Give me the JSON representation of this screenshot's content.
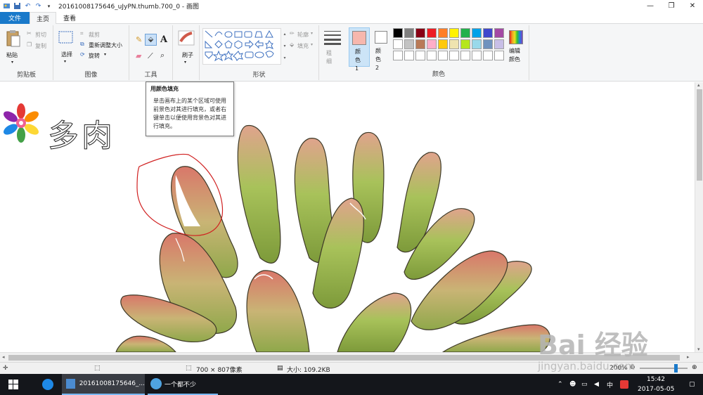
{
  "title_bar": {
    "title": "20161008175646_uJyPN.thumb.700_0 - 画图",
    "minimize": "—",
    "maximize": "❐",
    "close": "✕"
  },
  "tabs": {
    "file": "文件",
    "home": "主页",
    "view": "查看"
  },
  "ribbon": {
    "clipboard": {
      "paste": "粘贴",
      "cut": "剪切",
      "copy": "复制",
      "label": "剪贴板"
    },
    "image": {
      "select": "选择",
      "crop": "裁剪",
      "resize": "重新调整大小",
      "rotate": "旋转",
      "label": "图像"
    },
    "tools": {
      "label": "工具"
    },
    "brushes": {
      "label": "刷子"
    },
    "shapes": {
      "outline": "轮廓",
      "fill": "填充",
      "label": "形状"
    },
    "size": {
      "label": "粗细"
    },
    "colors": {
      "color1": "颜色 1",
      "color2": "颜色 2",
      "edit": "编辑颜色",
      "label": "颜色",
      "color1_value": "#f7b7ad",
      "color2_value": "#ffffff",
      "palette_row1": [
        "#000000",
        "#7f7f7f",
        "#880015",
        "#ed1c24",
        "#ff7f27",
        "#fff200",
        "#22b14c",
        "#00a2e8",
        "#3f48cc",
        "#a349a4"
      ],
      "palette_row2": [
        "#ffffff",
        "#c3c3c3",
        "#b97a57",
        "#ffaec9",
        "#ffc90e",
        "#efe4b0",
        "#b5e61d",
        "#99d9ea",
        "#7092be",
        "#c8bfe7"
      ]
    }
  },
  "tooltip": {
    "title": "用颜色填充",
    "body": "单击画布上的某个区域可使用前景色对其进行填充，或者右键单击以便使用背景色对其进行填充。"
  },
  "canvas": {
    "heading": "多肉"
  },
  "status_bar": {
    "dimensions": "700 × 807像素",
    "file_size": "大小: 109.2KB",
    "zoom": "200%",
    "zoom_level": 0.75
  },
  "taskbar": {
    "app1": "20161008175646_...",
    "app2": "一个都不少",
    "ime": "中",
    "time": "15:42",
    "date": "2017-05-05"
  },
  "watermark": {
    "text": "Bai 经验",
    "url": "jingyan.baidu.com"
  }
}
